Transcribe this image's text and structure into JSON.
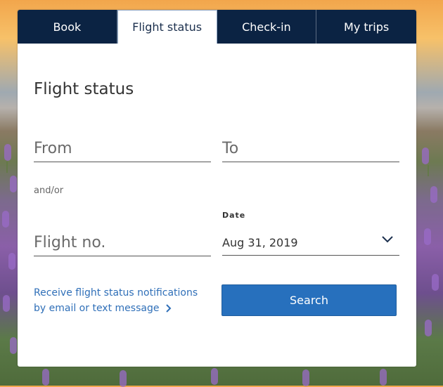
{
  "tabs": [
    {
      "label": "Book"
    },
    {
      "label": "Flight status"
    },
    {
      "label": "Check-in"
    },
    {
      "label": "My trips"
    }
  ],
  "active_tab": "Flight status",
  "form": {
    "title": "Flight status",
    "from_placeholder": "From",
    "to_placeholder": "To",
    "andor_label": "and/or",
    "flight_placeholder": "Flight no.",
    "date_label": "Date",
    "date_value": "Aug 31, 2019",
    "notify_text": "Receive flight status notifications by email or text message",
    "search_label": "Search"
  },
  "icons": {
    "date_dropdown": "chevron-down-icon",
    "notify_link": "chevron-right-icon"
  },
  "colors": {
    "tab_bg": "#0b2343",
    "link": "#2f6fb8",
    "button": "#2770bd"
  }
}
